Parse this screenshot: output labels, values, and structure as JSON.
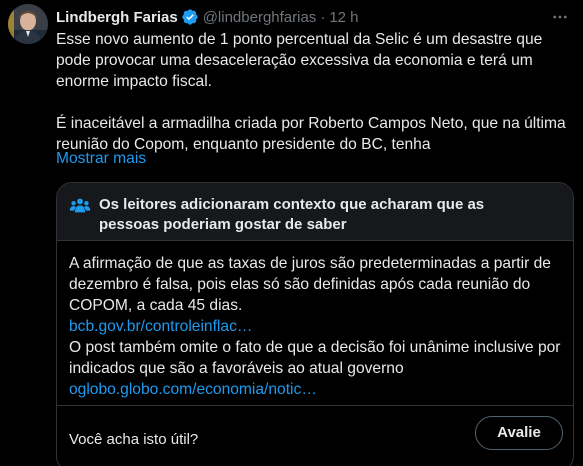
{
  "author": {
    "name": "Lindbergh Farias",
    "handle": "@lindberghfarias",
    "separator": "·",
    "time": "12 h",
    "verified_color": "#1d9bf0"
  },
  "tweet": {
    "paragraph1": "Esse novo aumento de 1 ponto percentual da Selic é um desastre que pode provocar uma desaceleração excessiva da economia e terá um enorme impacto fiscal.",
    "paragraph2": "É inaceitável a armadilha criada por Roberto Campos Neto, que na última reunião do Copom, enquanto presidente do BC, tenha",
    "show_more": "Mostrar mais"
  },
  "note": {
    "title": "Os leitores adicionaram contexto que acharam que as pessoas poderiam gostar de saber",
    "paragraph1": "A afirmação de que as taxas de juros são predeterminadas a partir de dezembro é falsa, pois elas só são definidas após cada reunião do COPOM, a cada 45 dias.",
    "link1": "bcb.gov.br/controleinflac…",
    "paragraph2": "O post também omite o fato de que a decisão foi unânime inclusive por indicados que são a favoráveis ao atual governo",
    "link2": "oglobo.globo.com/economia/notic…",
    "question": "Você acha isto útil?",
    "rate_button": "Avalie",
    "accent_color": "#1d9bf0"
  },
  "icons": {
    "verified": "verified-badge-icon",
    "more": "more-options-icon",
    "people": "people-icon"
  }
}
